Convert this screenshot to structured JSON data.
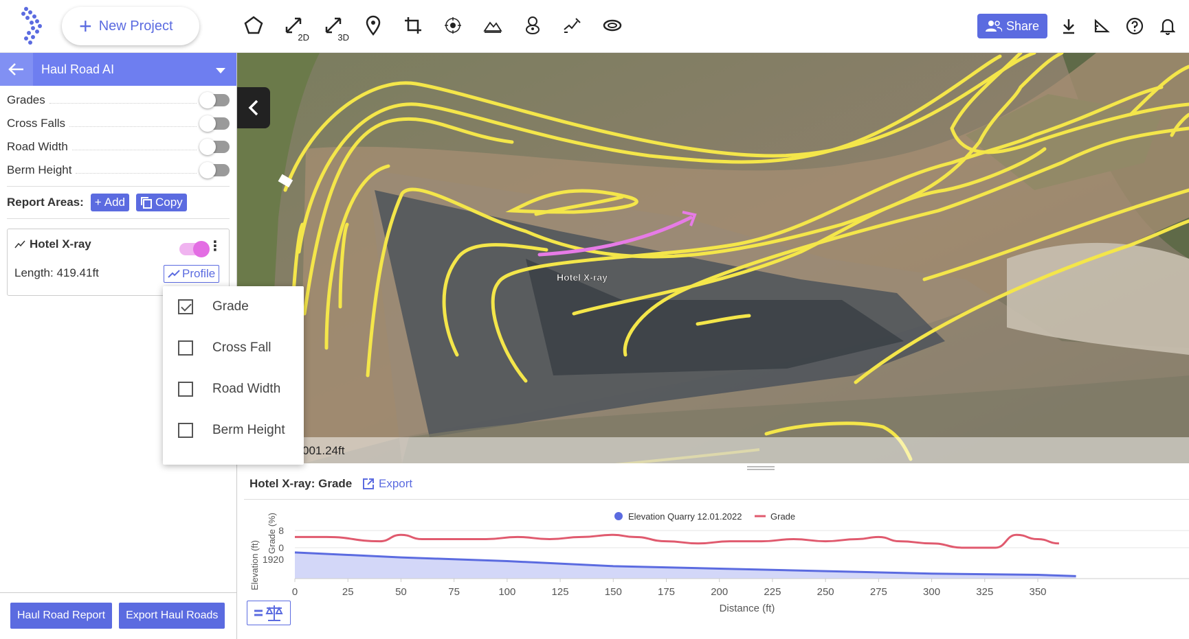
{
  "toolbar": {
    "new_project_label": "New Project",
    "tool_2d_sub": "2D",
    "tool_3d_sub": "3D",
    "share_label": "Share",
    "icons": [
      "polygon-icon",
      "measure-2d-icon",
      "measure-3d-icon",
      "location-pin-icon",
      "crop-icon",
      "target-icon",
      "terrain-icon",
      "stockpile-icon",
      "survey-icon",
      "inspect-icon"
    ]
  },
  "sidebar": {
    "layer_name": "Haul Road AI",
    "toggles": [
      {
        "label": "Grades",
        "on": false
      },
      {
        "label": "Cross Falls",
        "on": false
      },
      {
        "label": "Road Width",
        "on": false
      },
      {
        "label": "Berm Height",
        "on": false
      }
    ],
    "report_areas_label": "Report Areas:",
    "add_label": "Add",
    "copy_label": "Copy",
    "card": {
      "name": "Hotel X-ray",
      "length": "Length: 419.41ft",
      "profile_label": "Profile"
    },
    "report_button": "Haul Road Report",
    "export_button": "Export Haul Roads"
  },
  "profile_menu": {
    "options": [
      {
        "label": "Grade",
        "checked": true
      },
      {
        "label": "Cross Fall",
        "checked": false
      },
      {
        "label": "Road Width",
        "checked": false
      },
      {
        "label": "Berm Height",
        "checked": false
      }
    ]
  },
  "map": {
    "route_label": "Hotel X-ray",
    "scale_text": "001.24ft"
  },
  "chart_panel": {
    "title": "Hotel X-ray: Grade",
    "export_label": "Export"
  },
  "chart_data": {
    "type": "line",
    "xlabel": "Distance (ft)",
    "ylabel_top": "Grade (%)",
    "ylabel_bottom": "Elevation (ft)",
    "x_ticks": [
      0,
      25,
      50,
      75,
      100,
      125,
      150,
      175,
      200,
      225,
      250,
      275,
      300,
      325,
      350
    ],
    "y_top_ticks": [
      8,
      0
    ],
    "y_bottom_ticks": [
      1920
    ],
    "legend": [
      {
        "name": "Elevation Quarry 12.01.2022",
        "color": "#5b6be0"
      },
      {
        "name": "Grade",
        "color": "#e05a6e"
      }
    ],
    "series": [
      {
        "name": "Grade",
        "x": [
          0,
          15,
          40,
          50,
          60,
          75,
          90,
          105,
          120,
          135,
          150,
          160,
          175,
          190,
          205,
          220,
          235,
          250,
          265,
          275,
          285,
          300,
          315,
          330,
          340,
          350,
          360
        ],
        "values": [
          5,
          5,
          3,
          6,
          4,
          4,
          4,
          5,
          4,
          5,
          6,
          5,
          3,
          2,
          3,
          3,
          4,
          3,
          4,
          5,
          3,
          2,
          0,
          0,
          6,
          4,
          2
        ]
      },
      {
        "name": "Elevation Quarry 12.01.2022",
        "x": [
          0,
          50,
          100,
          150,
          200,
          250,
          300,
          350,
          368
        ],
        "values": [
          1925,
          1921,
          1918,
          1914,
          1912,
          1910,
          1908,
          1907,
          1906
        ]
      }
    ]
  }
}
